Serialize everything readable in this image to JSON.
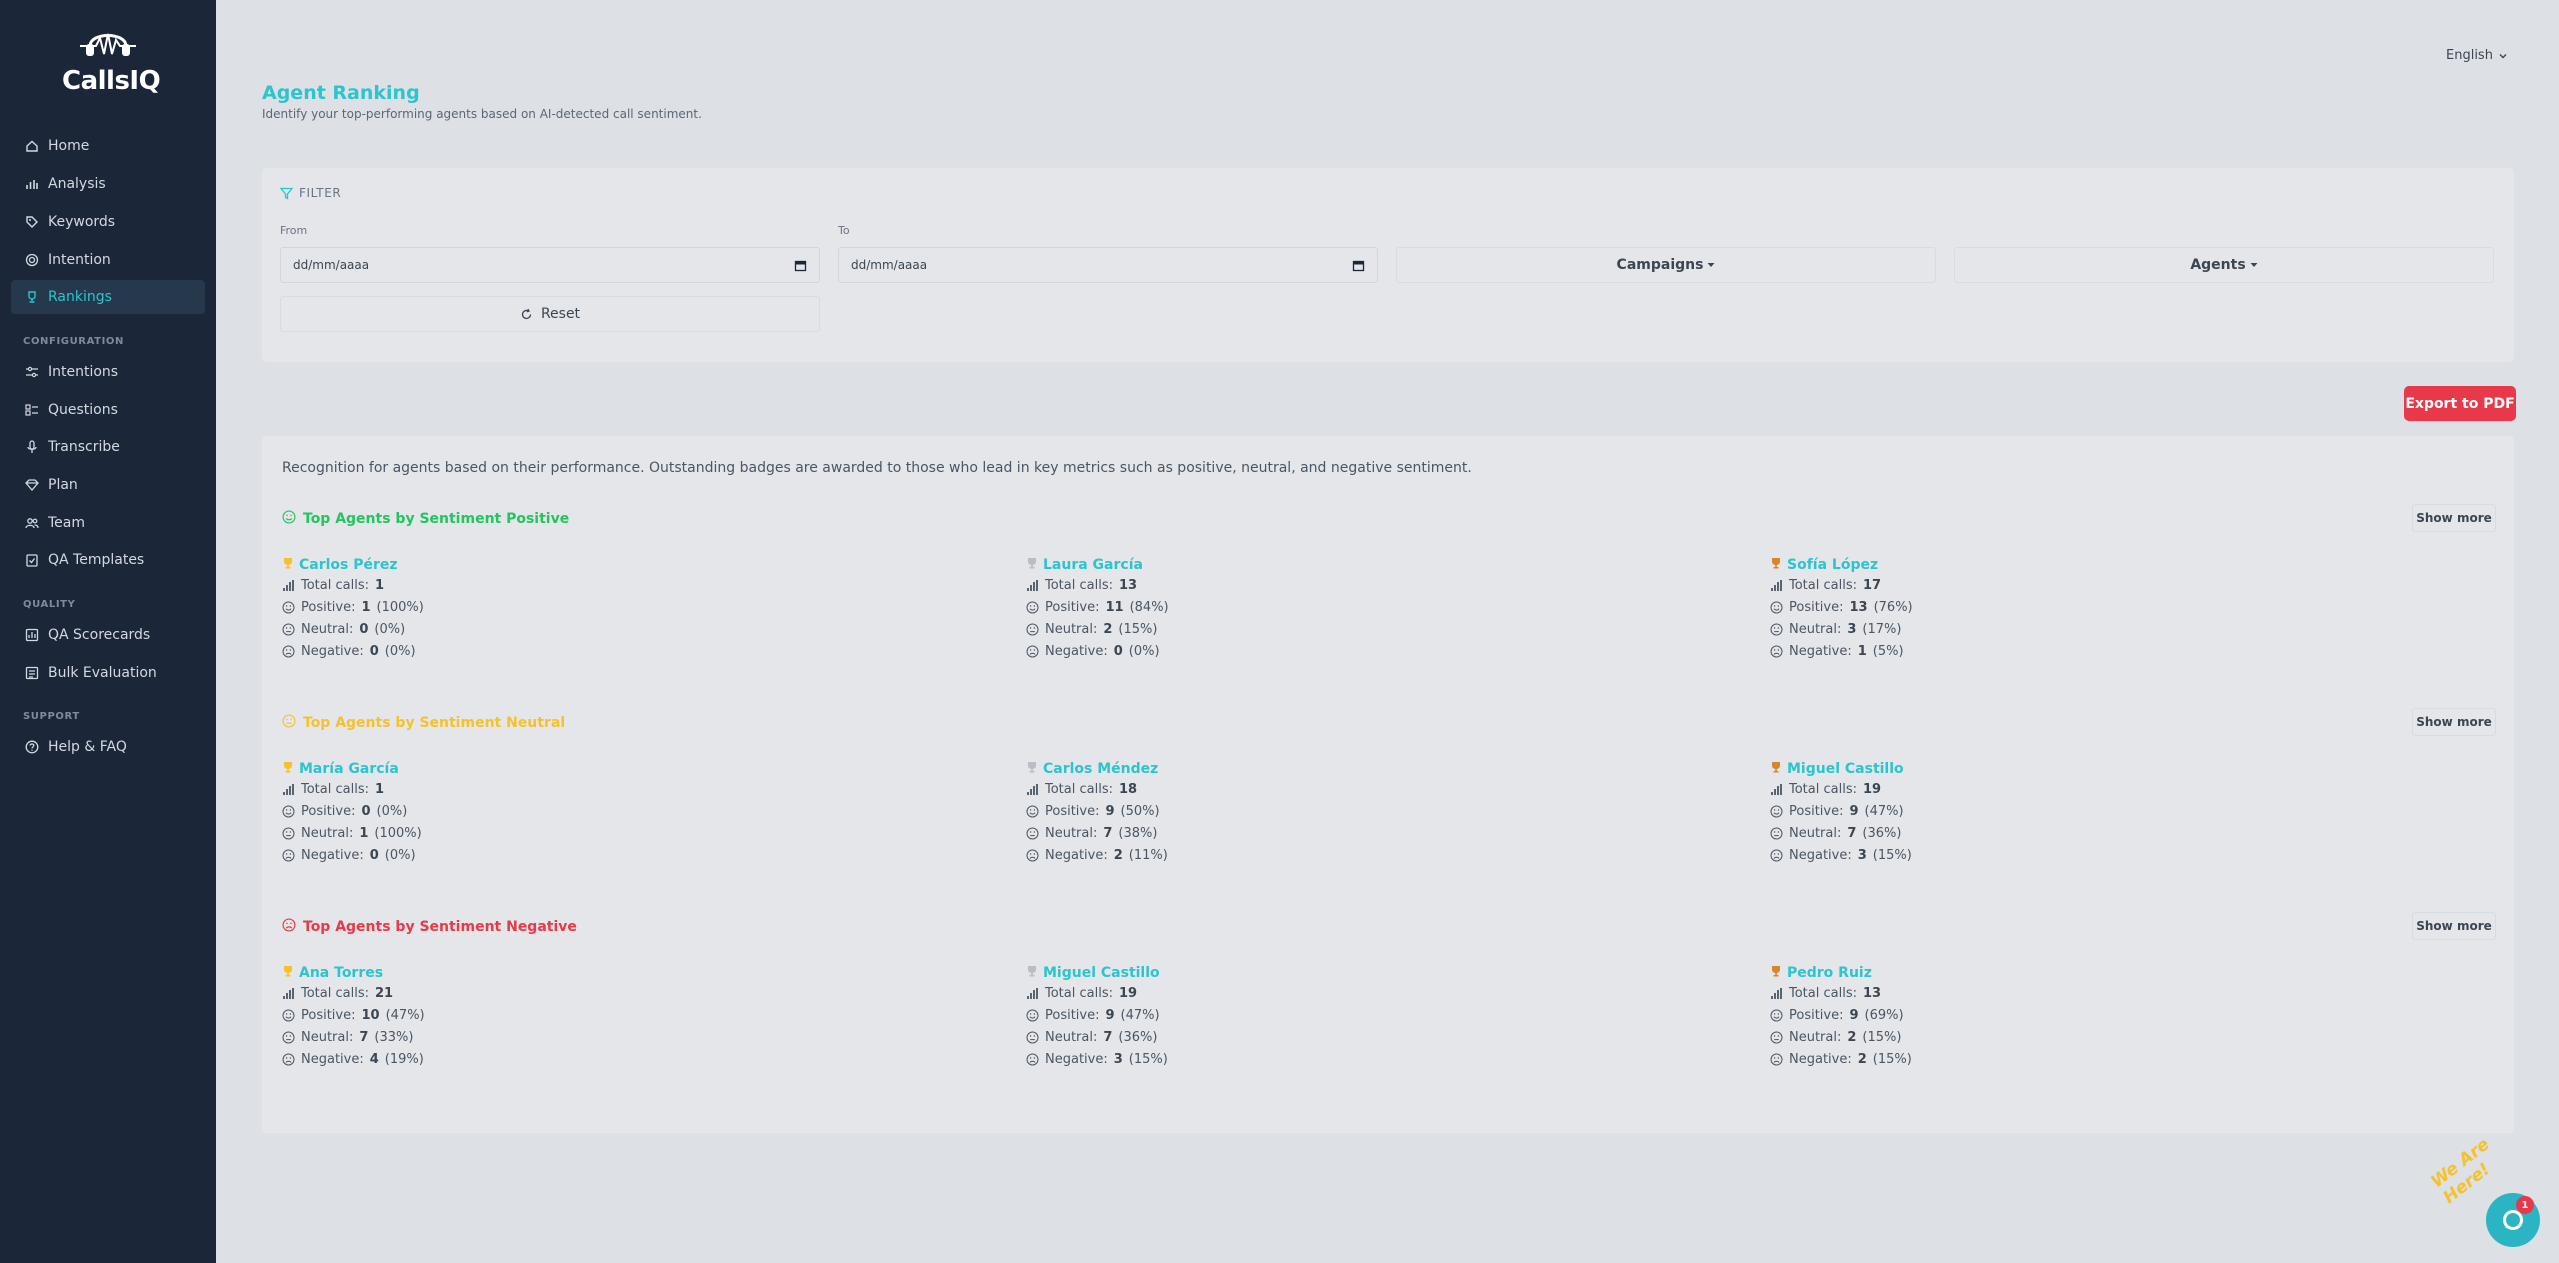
{
  "app": {
    "name": "CallsIQ"
  },
  "sidebar": {
    "items": [
      {
        "label": "Home",
        "icon": "home-icon"
      },
      {
        "label": "Analysis",
        "icon": "bar-chart-icon"
      },
      {
        "label": "Keywords",
        "icon": "tag-icon"
      },
      {
        "label": "Intention",
        "icon": "target-icon"
      },
      {
        "label": "Rankings",
        "icon": "trophy-icon",
        "active": true
      }
    ],
    "config_heading": "CONFIGURATION",
    "config_items": [
      {
        "label": "Intentions",
        "icon": "sliders-icon"
      },
      {
        "label": "Questions",
        "icon": "checklist-icon"
      },
      {
        "label": "Transcribe",
        "icon": "microphone-icon"
      },
      {
        "label": "Plan",
        "icon": "diamond-icon"
      },
      {
        "label": "Team",
        "icon": "users-icon"
      },
      {
        "label": "QA Templates",
        "icon": "clipboard-check-icon"
      }
    ],
    "quality_heading": "QUALITY",
    "quality_items": [
      {
        "label": "QA Scorecards",
        "icon": "scorecard-icon"
      },
      {
        "label": "Bulk Evaluation",
        "icon": "bulk-icon"
      }
    ],
    "support_heading": "SUPPORT",
    "support_items": [
      {
        "label": "Help & FAQ",
        "icon": "help-circle-icon"
      }
    ]
  },
  "header": {
    "language": "English"
  },
  "page": {
    "title": "Agent Ranking",
    "subtitle": "Identify your top-performing agents based on AI-detected call sentiment."
  },
  "filter": {
    "heading": "FILTER",
    "from_label": "From",
    "to_label": "To",
    "from_placeholder": "dd/mm/aaaa",
    "to_placeholder": "dd/mm/aaaa",
    "campaigns_label": "Campaigns",
    "agents_label": "Agents",
    "reset_label": "Reset"
  },
  "export_label": "Export to PDF",
  "results": {
    "description": "Recognition for agents based on their performance. Outstanding badges are awarded to those who lead in key metrics such as positive, neutral, and negative sentiment.",
    "show_more_label": "Show more",
    "stat_labels": {
      "total": "Total calls:",
      "positive": "Positive:",
      "neutral": "Neutral:",
      "negative": "Negative:"
    },
    "sections": [
      {
        "title": "Top Agents by Sentiment Positive",
        "color": "#22c55e",
        "agents": [
          {
            "name": "Carlos Pérez",
            "medal": "#f6c22b",
            "total": "1",
            "positive": "1",
            "positive_pct": "(100%)",
            "neutral": "0",
            "neutral_pct": "(0%)",
            "negative": "0",
            "negative_pct": "(0%)"
          },
          {
            "name": "Laura García",
            "medal": "#b9bec6",
            "total": "13",
            "positive": "11",
            "positive_pct": "(84%)",
            "neutral": "2",
            "neutral_pct": "(15%)",
            "negative": "0",
            "negative_pct": "(0%)"
          },
          {
            "name": "Sofía López",
            "medal": "#d8862b",
            "total": "17",
            "positive": "13",
            "positive_pct": "(76%)",
            "neutral": "3",
            "neutral_pct": "(17%)",
            "negative": "1",
            "negative_pct": "(5%)"
          }
        ]
      },
      {
        "title": "Top Agents by Sentiment Neutral",
        "color": "#f6c22b",
        "agents": [
          {
            "name": "María García",
            "medal": "#f6c22b",
            "total": "1",
            "positive": "0",
            "positive_pct": "(0%)",
            "neutral": "1",
            "neutral_pct": "(100%)",
            "negative": "0",
            "negative_pct": "(0%)"
          },
          {
            "name": "Carlos Méndez",
            "medal": "#b9bec6",
            "total": "18",
            "positive": "9",
            "positive_pct": "(50%)",
            "neutral": "7",
            "neutral_pct": "(38%)",
            "negative": "2",
            "negative_pct": "(11%)"
          },
          {
            "name": "Miguel Castillo",
            "medal": "#d8862b",
            "total": "19",
            "positive": "9",
            "positive_pct": "(47%)",
            "neutral": "7",
            "neutral_pct": "(36%)",
            "negative": "3",
            "negative_pct": "(15%)"
          }
        ]
      },
      {
        "title": "Top Agents by Sentiment Negative",
        "color": "#e8394a",
        "agents": [
          {
            "name": "Ana Torres",
            "medal": "#f6c22b",
            "total": "21",
            "positive": "10",
            "positive_pct": "(47%)",
            "neutral": "7",
            "neutral_pct": "(33%)",
            "negative": "4",
            "negative_pct": "(19%)"
          },
          {
            "name": "Miguel Castillo",
            "medal": "#b9bec6",
            "total": "19",
            "positive": "9",
            "positive_pct": "(47%)",
            "neutral": "7",
            "neutral_pct": "(36%)",
            "negative": "3",
            "negative_pct": "(15%)"
          },
          {
            "name": "Pedro Ruiz",
            "medal": "#d8862b",
            "total": "13",
            "positive": "9",
            "positive_pct": "(69%)",
            "neutral": "2",
            "neutral_pct": "(15%)",
            "negative": "2",
            "negative_pct": "(15%)"
          }
        ]
      }
    ]
  },
  "chat": {
    "label": "We Are Here!",
    "badge": "1"
  }
}
